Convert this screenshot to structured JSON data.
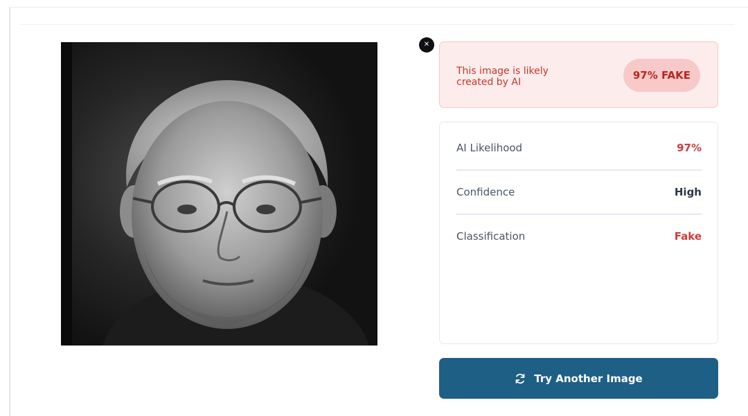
{
  "photo": {
    "description_icon": "portrait-photo"
  },
  "close": {
    "icon": "close-icon"
  },
  "verdict": {
    "message": "This image is likely created by AI",
    "badge": "97% FAKE"
  },
  "details": {
    "rows": [
      {
        "label": "AI Likelihood",
        "value": "97%"
      },
      {
        "label": "Confidence",
        "value": "High"
      },
      {
        "label": "Classification",
        "value": "Fake"
      }
    ]
  },
  "action": {
    "try_another_label": "Try Another Image",
    "icon": "refresh-icon"
  },
  "colors": {
    "accent": "#1e5f86",
    "fake_red": "#d23b3b",
    "verdict_bg": "#fdecec"
  }
}
